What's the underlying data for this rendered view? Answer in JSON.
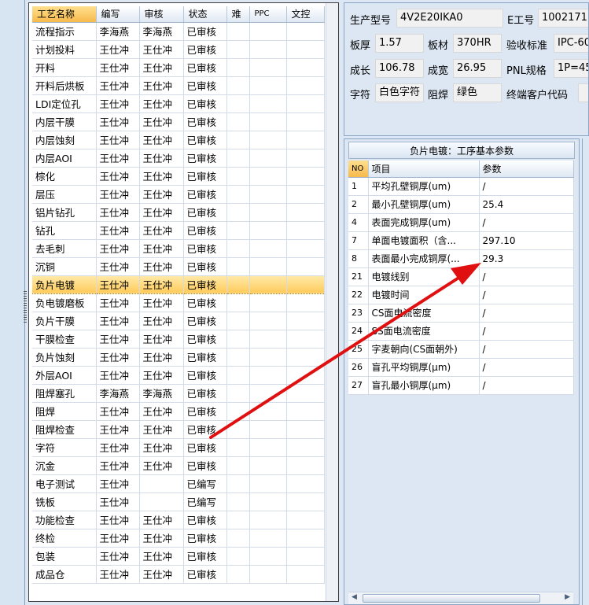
{
  "process_table": {
    "headers": [
      "工艺名称",
      "编写",
      "审核",
      "状态",
      "难",
      "PPC",
      "文控"
    ],
    "selected_index": 14,
    "rows": [
      [
        "流程指示",
        "李海燕",
        "李海燕",
        "已审核"
      ],
      [
        "计划投料",
        "王仕冲",
        "王仕冲",
        "已审核"
      ],
      [
        "开料",
        "王仕冲",
        "王仕冲",
        "已审核"
      ],
      [
        "开料后烘板",
        "王仕冲",
        "王仕冲",
        "已审核"
      ],
      [
        "LDI定位孔",
        "王仕冲",
        "王仕冲",
        "已审核"
      ],
      [
        "内层干膜",
        "王仕冲",
        "王仕冲",
        "已审核"
      ],
      [
        "内层蚀刻",
        "王仕冲",
        "王仕冲",
        "已审核"
      ],
      [
        "内层AOI",
        "王仕冲",
        "王仕冲",
        "已审核"
      ],
      [
        "棕化",
        "王仕冲",
        "王仕冲",
        "已审核"
      ],
      [
        "层压",
        "王仕冲",
        "王仕冲",
        "已审核"
      ],
      [
        "铝片钻孔",
        "王仕冲",
        "王仕冲",
        "已审核"
      ],
      [
        "钻孔",
        "王仕冲",
        "王仕冲",
        "已审核"
      ],
      [
        "去毛刺",
        "王仕冲",
        "王仕冲",
        "已审核"
      ],
      [
        "沉铜",
        "王仕冲",
        "王仕冲",
        "已审核"
      ],
      [
        "负片电镀",
        "王仕冲",
        "王仕冲",
        "已审核"
      ],
      [
        "负电镀磨板",
        "王仕冲",
        "王仕冲",
        "已审核"
      ],
      [
        "负片干膜",
        "王仕冲",
        "王仕冲",
        "已审核"
      ],
      [
        "干膜检查",
        "王仕冲",
        "王仕冲",
        "已审核"
      ],
      [
        "负片蚀刻",
        "王仕冲",
        "王仕冲",
        "已审核"
      ],
      [
        "外层AOI",
        "王仕冲",
        "王仕冲",
        "已审核"
      ],
      [
        "阻焊塞孔",
        "李海燕",
        "李海燕",
        "已审核"
      ],
      [
        "阻焊",
        "王仕冲",
        "王仕冲",
        "已审核"
      ],
      [
        "阻焊检查",
        "王仕冲",
        "王仕冲",
        "已审核"
      ],
      [
        "字符",
        "王仕冲",
        "王仕冲",
        "已审核"
      ],
      [
        "沉金",
        "王仕冲",
        "王仕冲",
        "已审核"
      ],
      [
        "电子测试",
        "王仕冲",
        "",
        "已编写"
      ],
      [
        "铣板",
        "王仕冲",
        "",
        "已编写"
      ],
      [
        "功能检查",
        "王仕冲",
        "王仕冲",
        "已审核"
      ],
      [
        "终检",
        "王仕冲",
        "王仕冲",
        "已审核"
      ],
      [
        "包装",
        "王仕冲",
        "王仕冲",
        "已审核"
      ],
      [
        "成品仓",
        "王仕冲",
        "王仕冲",
        "已审核"
      ]
    ]
  },
  "info": {
    "model_label": "生产型号",
    "model_value": "4V2E20IKA0",
    "eno_label": "E工号",
    "eno_value": "1002171",
    "thickness_label": "板厚",
    "thickness_value": "1.57",
    "material_label": "板材",
    "material_value": "370HR",
    "standard_label": "验收标准",
    "standard_value": "IPC-60",
    "length_label": "成长",
    "length_value": "106.78",
    "width_label": "成宽",
    "width_value": "26.95",
    "pnl_label": "PNL规格",
    "pnl_value": "1P=45",
    "char_label": "字符",
    "char_value": "白色字符",
    "mask_label": "阻焊",
    "mask_value": "绿色",
    "customer_label": "终端客户代码",
    "customer_value": ""
  },
  "params": {
    "title": "负片电镀：工序基本参数",
    "headers": [
      "NO",
      "项目",
      "参数"
    ],
    "rows": [
      [
        "1",
        "平均孔壁铜厚(um)",
        "/"
      ],
      [
        "2",
        "最小孔壁铜厚(um)",
        "25.4"
      ],
      [
        "4",
        "表面完成铜厚(um)",
        "/"
      ],
      [
        "7",
        "单面电镀面积（含...",
        "297.10"
      ],
      [
        "8",
        "表面最小完成铜厚(...",
        "29.3"
      ],
      [
        "21",
        "电镀线别",
        "/"
      ],
      [
        "22",
        "电镀时间",
        "/"
      ],
      [
        "23",
        "CS面电流密度",
        "/"
      ],
      [
        "24",
        "SS面电流密度",
        "/"
      ],
      [
        "25",
        "字麦朝向(CS面朝外)",
        "/"
      ],
      [
        "26",
        "盲孔平均铜厚(μm)",
        "/"
      ],
      [
        "27",
        "盲孔最小铜厚(μm)",
        "/"
      ]
    ]
  },
  "colors": {
    "selection": "#ffcb5c",
    "arrow": "#e01010"
  }
}
